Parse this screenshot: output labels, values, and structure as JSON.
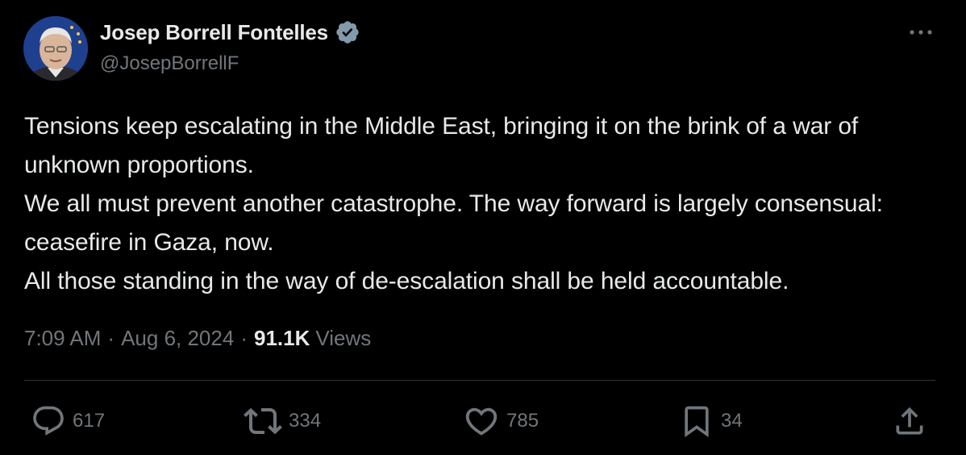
{
  "author": {
    "display_name": "Josep Borrell Fontelles",
    "handle": "@JosepBorrellF",
    "verified_color": "#829aab"
  },
  "tweet": {
    "lines": [
      "Tensions keep escalating in the Middle East, bringing it on the brink of a war of unknown proportions.",
      "We all must prevent another catastrophe. The way forward is largely consensual: ceasefire in Gaza, now.",
      "All those standing in the way of de-escalation shall be held accountable."
    ],
    "time": "7:09 AM",
    "separator": "·",
    "date": "Aug 6, 2024",
    "views_count": "91.1K",
    "views_label": "Views"
  },
  "actions": {
    "replies": {
      "icon": "reply-icon",
      "count": "617"
    },
    "reposts": {
      "icon": "repost-icon",
      "count": "334"
    },
    "likes": {
      "icon": "heart-icon",
      "count": "785"
    },
    "bookmarks": {
      "icon": "bookmark-icon",
      "count": "34"
    },
    "share": {
      "icon": "share-icon"
    }
  },
  "colors": {
    "background": "#000000",
    "text_primary": "#e7e9ea",
    "text_secondary": "#71767b",
    "divider": "#2f3336"
  }
}
